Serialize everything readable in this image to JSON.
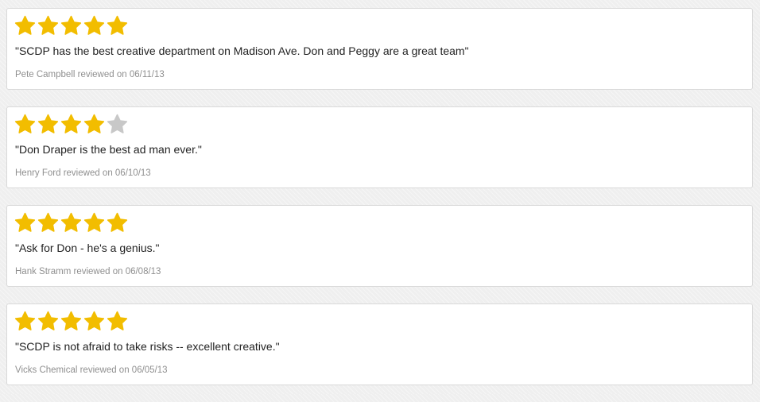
{
  "colors": {
    "star_filled": "#F2BD00",
    "star_empty": "#C8C8C8"
  },
  "reviews": [
    {
      "rating": 5,
      "max_rating": 5,
      "quote": "\"SCDP has the best creative department on Madison Ave. Don and Peggy are a great team\"",
      "meta": "Pete Campbell reviewed on 06/11/13"
    },
    {
      "rating": 4,
      "max_rating": 5,
      "quote": "\"Don Draper is the best ad man ever.\"",
      "meta": "Henry Ford reviewed on 06/10/13"
    },
    {
      "rating": 5,
      "max_rating": 5,
      "quote": "\"Ask for Don - he's a genius.\"",
      "meta": "Hank Stramm reviewed on 06/08/13"
    },
    {
      "rating": 5,
      "max_rating": 5,
      "quote": "\"SCDP is not afraid to take risks -- excellent creative.\"",
      "meta": "Vicks Chemical reviewed on 06/05/13"
    }
  ]
}
